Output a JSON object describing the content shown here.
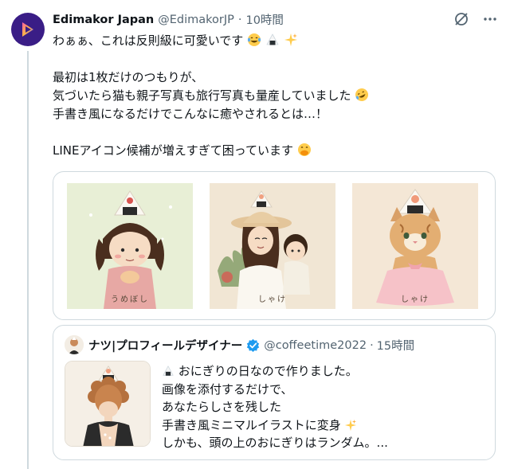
{
  "tweet": {
    "author_name": "Edimakor Japan",
    "handle": "@EdimakorJP",
    "separator": "·",
    "time": "10時間",
    "lines": [
      "わぁぁ、これは反則級に可愛いです",
      "最初は1枚だけのつもりが、",
      "気づいたら猫も親子写真も旅行写真も量産していました",
      "手書き風になるだけでこんなに癒やされるとは…！",
      "LINEアイコン候補が増えすぎて困っています"
    ],
    "emojis": {
      "line0": [
        "tears-of-joy-emoji",
        "onigiri-emoji",
        "sparkles-emoji"
      ],
      "line2": [
        "rofl-emoji"
      ],
      "line4": [
        "hand-over-mouth-emoji"
      ]
    }
  },
  "media": {
    "images": [
      {
        "caption": "うめぼし",
        "subject": "girl-with-onigiri-hat",
        "accent": "#e0a8a0"
      },
      {
        "caption": "しゃけ",
        "subject": "mother-and-child-with-onigiri-hat",
        "accent": "#f0a080"
      },
      {
        "caption": "しゃけ",
        "subject": "cat-in-pink-dress-with-onigiri-hat",
        "accent": "#f09a7a"
      }
    ]
  },
  "quote": {
    "author_name": "ナツ|プロフィールデザイナー",
    "handle": "@coffeetime2022",
    "separator": "·",
    "time": "15時間",
    "lines": [
      "おにぎりの日なので作りました。",
      "画像を添付するだけで、",
      "あなたらしさを残した",
      "手書き風ミニマルイラストに変身",
      "しかも、頭の上のおにぎりはランダム。..."
    ]
  },
  "colors": {
    "text": "#0f1419",
    "secondary": "#536471",
    "border": "#cfd9de",
    "verified": "#1d9bf0",
    "brand": "#3a1d86"
  }
}
